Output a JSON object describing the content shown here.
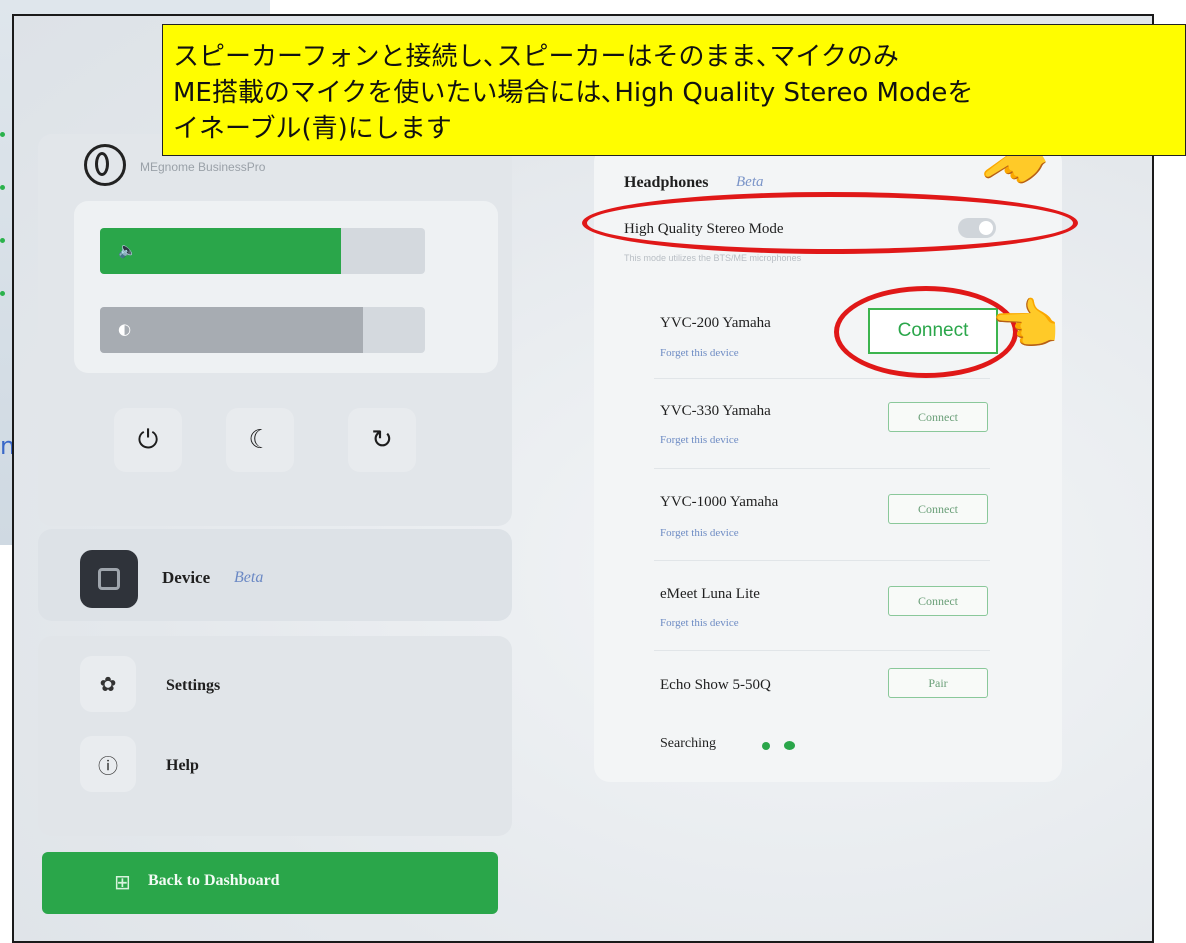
{
  "annotation": {
    "lines": [
      "スピーカーフォンと接続し､スピーカーはそのまま､マイクのみ",
      "ME搭載のマイクを使いたい場合には､High Quality Stereo Modeを",
      "イネーブル(青)にします"
    ],
    "highlight_color": "#fffd00",
    "circle_color": "#e01818",
    "pointer_emoji": "👉"
  },
  "sidebar": {
    "brand_text": "MEgnome     BusinessPro",
    "volume_level": 0.74,
    "brightness_level": 0.81,
    "volume_icon": "🔈",
    "brightness_icon": "◐",
    "power_icon": "⏻",
    "sleep_icon": "☾",
    "restart_icon": "↻",
    "device": {
      "label": "Device",
      "beta": "Beta"
    },
    "menu": [
      {
        "label": "Settings",
        "icon": "✿"
      },
      {
        "label": "Help",
        "icon": "ⓘ"
      }
    ],
    "back_button": {
      "label": "Back to Dashboard",
      "icon": "⊞"
    }
  },
  "headphones": {
    "title": "Headphones",
    "beta": "Beta",
    "hq_mode_label": "High Quality Stereo Mode",
    "hq_mode_desc": "This mode utilizes the BTS/ME microphones",
    "devices": [
      {
        "name": "YVC-200 Yamaha",
        "forget": "Forget this device",
        "action": "Connect"
      },
      {
        "name": "YVC-330 Yamaha",
        "forget": "Forget this device",
        "action": "Connect"
      },
      {
        "name": "YVC-1000 Yamaha",
        "forget": "Forget this device",
        "action": "Connect"
      },
      {
        "name": "eMeet Luna Lite",
        "forget": "Forget this device",
        "action": "Connect"
      },
      {
        "name": "Echo Show 5-50Q",
        "forget": "",
        "action": "Pair"
      }
    ],
    "searching": "Searching"
  },
  "colors": {
    "accent_green": "#2aa64a",
    "link_blue": "#6e8cc4"
  }
}
